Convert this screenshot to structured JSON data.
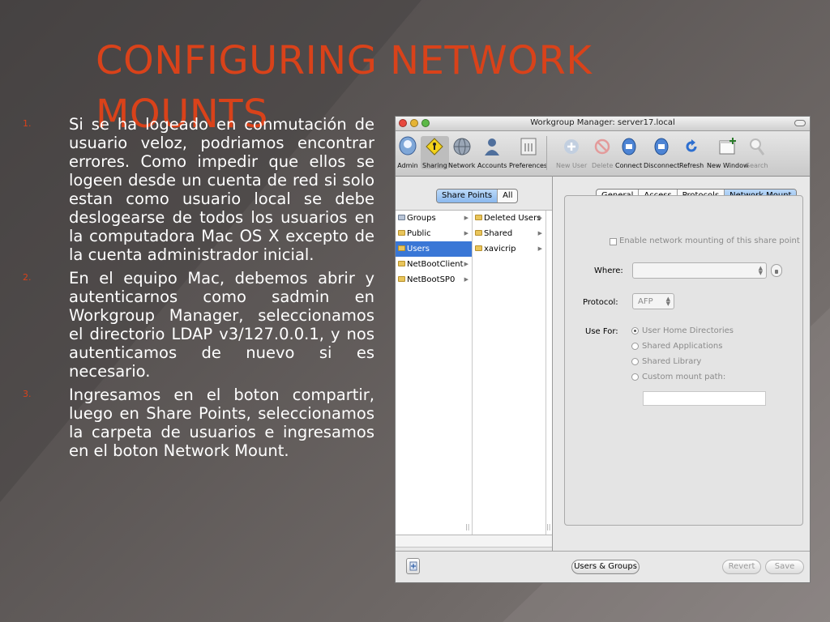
{
  "slide": {
    "title": "CONFIGURING NETWORK MOUNTS",
    "items": [
      {
        "num": "1.",
        "text": "Si se ha logeado en conmutación de usuario veloz, podriamos encontrar errores. Como impedir que ellos se logeen desde un cuenta de red si solo estan como usuario local se debe deslogearse de todos los usuarios en la computadora Mac OS X excepto de la cuenta administrador inicial."
      },
      {
        "num": "2.",
        "text": "En el equipo  Mac, debemos abrir y autenticarnos como sadmin en Workgroup Manager, seleccionamos el directorio LDAP v3/127.0.0.1, y nos autenticamos de nuevo si es necesario."
      },
      {
        "num": "3.",
        "text": "Ingresamos en el boton compartir, luego en Share Points, seleccionamos la carpeta de usuarios e ingresamos en el boton Network Mount."
      }
    ],
    "accent_color": "#d9421a"
  },
  "window": {
    "title": "Workgroup Manager: server17.local",
    "toolbar": {
      "left": [
        {
          "label": "Admin",
          "icon": "admin-icon"
        },
        {
          "label": "Sharing",
          "icon": "sharing-icon"
        },
        {
          "label": "Network",
          "icon": "network-icon"
        },
        {
          "label": "Accounts",
          "icon": "accounts-icon"
        },
        {
          "label": "Preferences",
          "icon": "preferences-icon"
        }
      ],
      "right": [
        {
          "label": "New User",
          "icon": "new-user-icon",
          "enabled": false
        },
        {
          "label": "Delete",
          "icon": "delete-icon",
          "enabled": false
        },
        {
          "label": "Connect",
          "icon": "connect-icon",
          "enabled": true
        },
        {
          "label": "Disconnect",
          "icon": "disconnect-icon",
          "enabled": true
        },
        {
          "label": "Refresh",
          "icon": "refresh-icon",
          "enabled": true
        },
        {
          "label": "New Window",
          "icon": "new-window-icon",
          "enabled": true
        },
        {
          "label": "Search",
          "icon": "search-icon",
          "enabled": false
        }
      ]
    },
    "left_tabs": {
      "share_points": "Share Points",
      "all": "All"
    },
    "browser": {
      "col1": [
        "Groups",
        "Public",
        "Users",
        "NetBootClient",
        "NetBootSP0"
      ],
      "col1_selected": "Users",
      "col2": [
        "Deleted Users",
        "Shared",
        "xavicrip"
      ]
    },
    "right_tabs": {
      "general": "General",
      "access": "Access",
      "protocols": "Protocols",
      "network_mount": "Network Mount"
    },
    "form": {
      "enable_label": "Enable network mounting of this share point",
      "where_label": "Where:",
      "protocol_label": "Protocol:",
      "protocol_value": "AFP",
      "use_for_label": "Use For:",
      "options": [
        "User Home Directories",
        "Shared Applications",
        "Shared Library",
        "Custom mount path:"
      ],
      "selected_option": "User Home Directories"
    },
    "buttons": {
      "users_groups": "Users & Groups",
      "revert": "Revert",
      "save": "Save"
    }
  }
}
